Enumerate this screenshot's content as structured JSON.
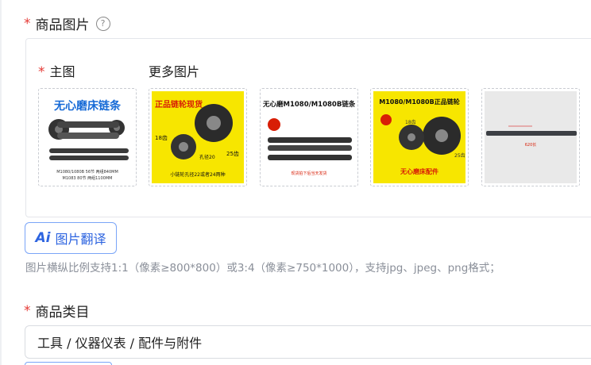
{
  "images_section": {
    "required_mark": "*",
    "title": "商品图片",
    "help_icon": "question-circle-icon",
    "main_label": "主图",
    "more_label": "更多图片",
    "thumbnails": [
      {
        "title": "无心磨床链条",
        "caption1": "M1080/1080B 56节 两组840MM",
        "caption2": "M1083 80节 两组1100MM"
      },
      {
        "title": "正品链轮现货",
        "teeth_a": "18齿",
        "teeth_b": "25齿",
        "bore": "孔径20",
        "caption": "小链轮孔径22或者24两种"
      },
      {
        "title": "无心磨M1080/M1080B链条",
        "caption": "现货拍下后当天发货"
      },
      {
        "title": "M1080/M1080B正品链轮",
        "teeth_a": "18齿",
        "teeth_b": "25齿",
        "caption": "无心磨床配件"
      },
      {
        "caption": "620长"
      }
    ]
  },
  "translate_button": {
    "icon": "Ai",
    "label": "图片翻译"
  },
  "hint": "图片横纵比例支持1:1（像素≥800*800）或3:4（像素≥750*1000），支持jpg、jpeg、png格式；",
  "category_section": {
    "required_mark": "*",
    "title": "商品类目",
    "value": "工具 / 仪器仪表 / 配件与附件"
  },
  "colors": {
    "required": "#e53935",
    "accent": "#2d64e0",
    "hint": "#8a8f99"
  }
}
